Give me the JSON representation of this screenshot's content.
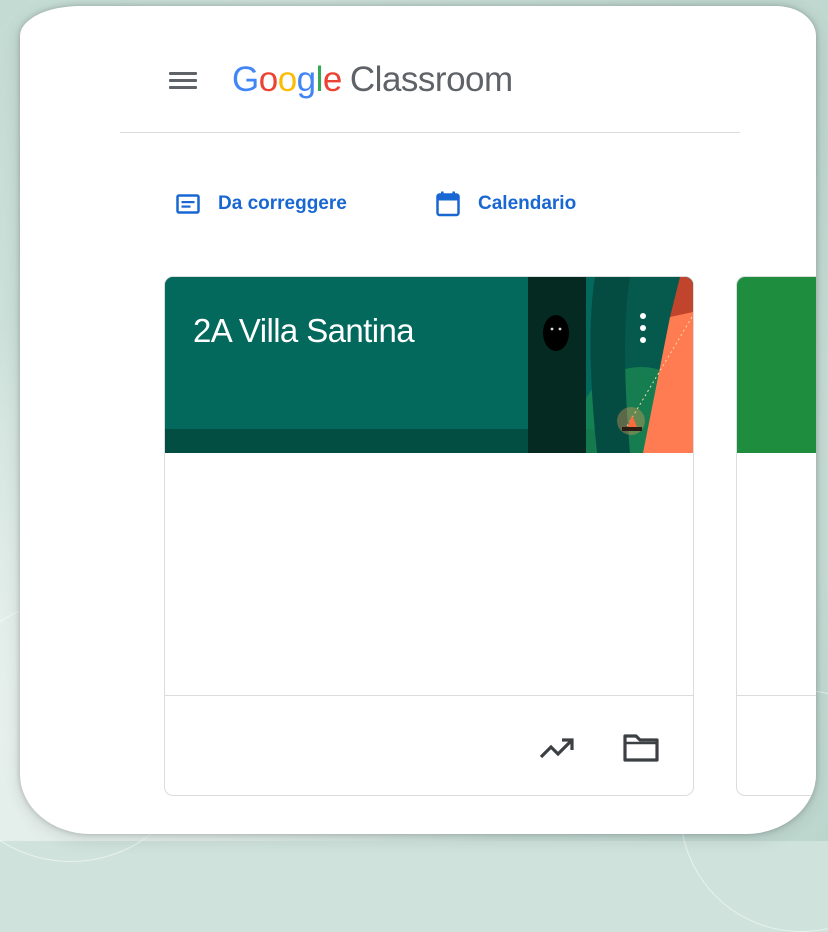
{
  "header": {
    "logo": {
      "letters": [
        "G",
        "o",
        "o",
        "g",
        "l",
        "e"
      ],
      "product": "Classroom"
    },
    "menu_icon": "hamburger-menu-icon"
  },
  "nav": {
    "to_review": {
      "label": "Da correggere",
      "icon": "assignment-icon"
    },
    "calendar": {
      "label": "Calendario",
      "icon": "calendar-icon"
    }
  },
  "classes": [
    {
      "name": "2A Villa Santina",
      "theme_color": "#03695c",
      "icons": [
        "more-vert-icon",
        "trending-up-icon",
        "folder-icon"
      ]
    }
  ],
  "colors": {
    "google_blue": "#4285F4",
    "google_red": "#EA4335",
    "google_yellow": "#FBBC05",
    "google_green": "#34A853",
    "link_blue": "#1967d2",
    "card_header": "#03695c",
    "next_card_header": "#1e8e3e"
  }
}
